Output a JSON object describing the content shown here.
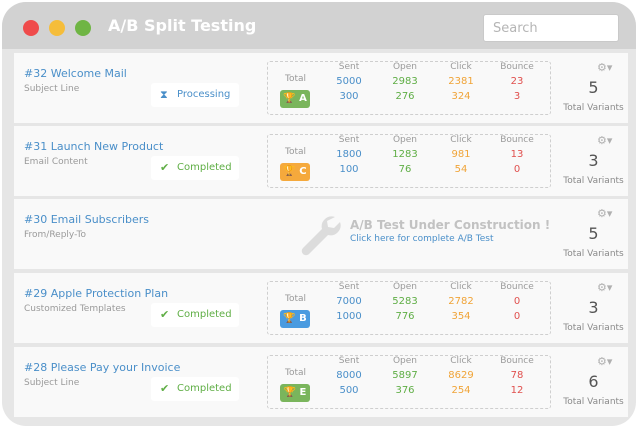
{
  "window": {
    "title": "A/B Split Testing"
  },
  "search": {
    "placeholder": "Search"
  },
  "labels": {
    "total": "Total",
    "sent": "Sent",
    "open": "Open",
    "click": "Click",
    "bounce": "Bounce",
    "total_variants": "Total Variants"
  },
  "colors": {
    "green": "#7ab55c",
    "orange": "#f5a93c",
    "blue": "#4a9be0"
  },
  "rows": [
    {
      "title": "#32 Welcome Mail",
      "subtitle": "Subject Line",
      "status": "Processing",
      "status_icon": "hourglass-icon",
      "winner": "A",
      "winner_color": "#7ab55c",
      "sent": [
        "5000",
        "300"
      ],
      "open": [
        "2983",
        "276"
      ],
      "click": [
        "2381",
        "324"
      ],
      "bounce": [
        "23",
        "3"
      ],
      "variants": "5"
    },
    {
      "title": "#31 Launch New Product",
      "subtitle": "Email Content",
      "status": "Completed",
      "status_icon": "checkmark-icon",
      "winner": "C",
      "winner_color": "#f5a93c",
      "sent": [
        "1800",
        "100"
      ],
      "open": [
        "1283",
        "76"
      ],
      "click": [
        "981",
        "54"
      ],
      "bounce": [
        "13",
        "0"
      ],
      "variants": "3"
    },
    {
      "title": "#30 Email Subscribers",
      "subtitle": "From/Reply-To",
      "construction_title": "A/B Test Under Construction !",
      "construction_link": "Click here for complete A/B Test",
      "variants": "5"
    },
    {
      "title": "#29 Apple Protection Plan",
      "subtitle": "Customized Templates",
      "status": "Completed",
      "status_icon": "checkmark-icon",
      "winner": "B",
      "winner_color": "#4a9be0",
      "sent": [
        "7000",
        "1000"
      ],
      "open": [
        "5283",
        "776"
      ],
      "click": [
        "2782",
        "354"
      ],
      "bounce": [
        "0",
        "0"
      ],
      "variants": "3"
    },
    {
      "title": "#28 Please Pay your Invoice",
      "subtitle": "Subject Line",
      "status": "Completed",
      "status_icon": "checkmark-icon",
      "winner": "E",
      "winner_color": "#7ab55c",
      "sent": [
        "8000",
        "500"
      ],
      "open": [
        "5897",
        "376"
      ],
      "click": [
        "8629",
        "254"
      ],
      "bounce": [
        "78",
        "12"
      ],
      "variants": "6"
    }
  ]
}
